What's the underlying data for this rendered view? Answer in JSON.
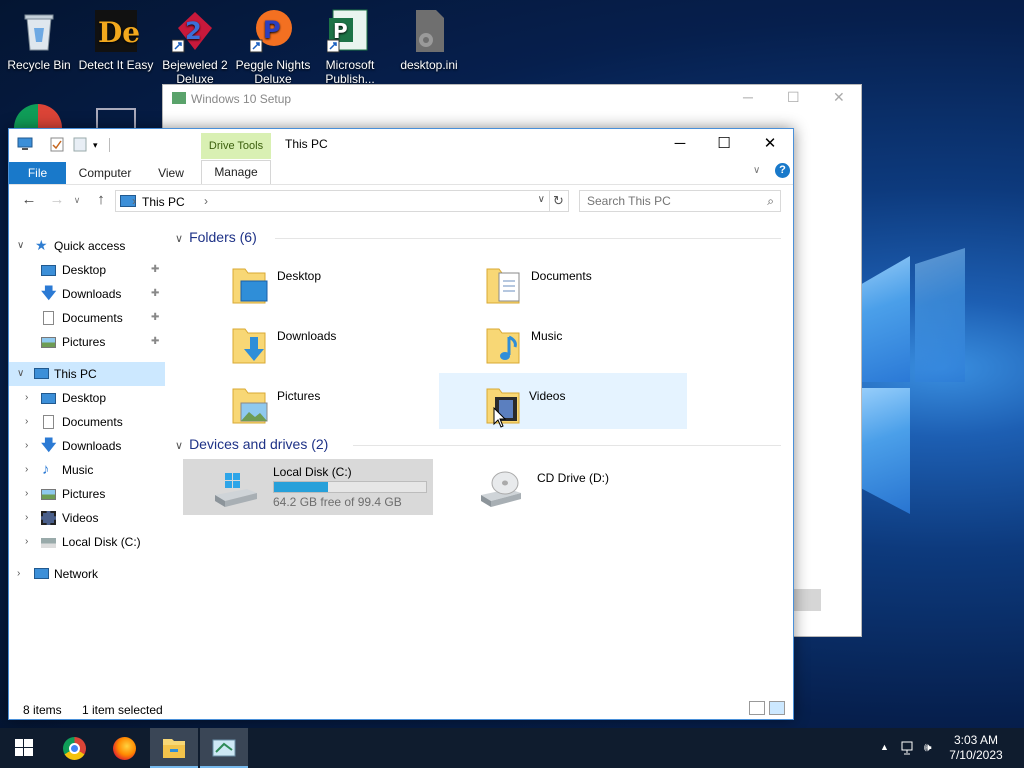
{
  "desktop": {
    "icons": [
      {
        "label": "Recycle Bin",
        "icon": "recycle-bin-icon"
      },
      {
        "label": "Detect It Easy",
        "icon": "detect-it-easy-icon"
      },
      {
        "label": "Bejeweled 2 Deluxe",
        "icon": "bejeweled-icon"
      },
      {
        "label": "Peggle Nights Deluxe",
        "icon": "peggle-icon"
      },
      {
        "label": "Microsoft Publish...",
        "icon": "publisher-icon"
      },
      {
        "label": "desktop.ini",
        "icon": "file-gear-icon"
      }
    ]
  },
  "setup_window": {
    "title": "Windows 10 Setup"
  },
  "explorer": {
    "title": "This PC",
    "context_tab_group": "Drive Tools",
    "tabs": [
      "File",
      "Computer",
      "View",
      "Manage"
    ],
    "window_controls": {
      "minimize": "─",
      "maximize": "☐",
      "close": "✕"
    },
    "address": {
      "crumb": "This PC"
    },
    "search": {
      "placeholder": "Search This PC"
    },
    "nav": {
      "quick_access": "Quick access",
      "quick_items": [
        "Desktop",
        "Downloads",
        "Documents",
        "Pictures"
      ],
      "this_pc": "This PC",
      "pc_items": [
        "Desktop",
        "Documents",
        "Downloads",
        "Music",
        "Pictures",
        "Videos",
        "Local Disk (C:)"
      ],
      "network": "Network"
    },
    "folders_header": "Folders (6)",
    "folders": [
      {
        "name": "Desktop",
        "icon": "desktop-folder-icon"
      },
      {
        "name": "Documents",
        "icon": "documents-folder-icon"
      },
      {
        "name": "Downloads",
        "icon": "downloads-folder-icon"
      },
      {
        "name": "Music",
        "icon": "music-folder-icon"
      },
      {
        "name": "Pictures",
        "icon": "pictures-folder-icon"
      },
      {
        "name": "Videos",
        "icon": "videos-folder-icon",
        "selected": true
      }
    ],
    "devices_header": "Devices and drives (2)",
    "drives": [
      {
        "name": "Local Disk (C:)",
        "free_text": "64.2 GB free of 99.4 GB",
        "used_fraction": 0.354,
        "selected": true
      },
      {
        "name": "CD Drive (D:)"
      }
    ],
    "status": {
      "items": "8 items",
      "selected": "1 item selected"
    }
  },
  "taskbar": {
    "time": "3:03 AM",
    "date": "7/10/2023",
    "apps": [
      "chrome-icon",
      "firefox-icon",
      "file-explorer-icon",
      "windows-setup-icon"
    ]
  },
  "colors": {
    "accent": "#1979ca",
    "drive_tools": "#d9f0b3",
    "selection": "#cce8ff",
    "drive_fill": "#26a0da"
  }
}
